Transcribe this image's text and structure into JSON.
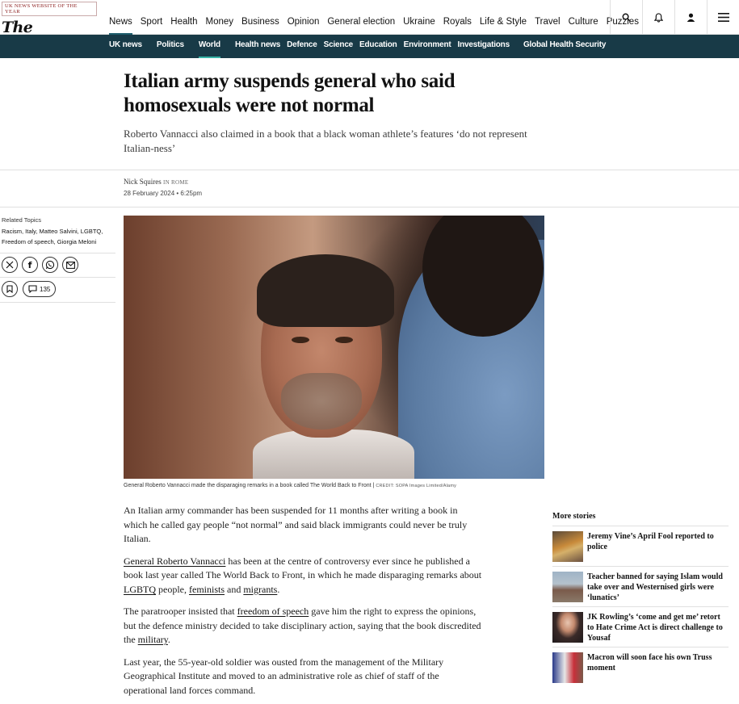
{
  "masthead": {
    "tagline": "UK NEWS WEBSITE OF THE YEAR",
    "logo": "The Telegraph",
    "nav": [
      "News",
      "Sport",
      "Health",
      "Money",
      "Business",
      "Opinion",
      "General election",
      "Ukraine",
      "Royals",
      "Life & Style",
      "Travel",
      "Culture",
      "Puzzles"
    ],
    "icons": [
      "search-icon",
      "bell-icon",
      "account-icon",
      "menu-icon"
    ]
  },
  "subnav": [
    "UK news",
    "Politics",
    "World",
    "Health news",
    "Defence",
    "Science",
    "Education",
    "Environment",
    "Investigations",
    "Global Health Security"
  ],
  "article": {
    "headline": "Italian army suspends general who said homosexuals were not normal",
    "standfirst": "Roberto Vannacci also claimed in a book that a black woman athlete’s features ‘do not represent Italian-ness’",
    "author": "Nick Squires",
    "location": "IN ROME",
    "date": "28 February 2024 • 6:25pm",
    "caption": "General Roberto Vannacci made the disparaging remarks in a book called The World Back to Front",
    "credit": "CREDIT: SOPA Images Limited/Alamy",
    "paragraphs": {
      "p1": "An Italian army commander has been suspended for 11 months after writing a book in which he called gay people “not normal” and said black immigrants could never be truly Italian.",
      "p2_link": "General Roberto Vannacci",
      "p2_a": " has been at the centre of controversy ever since he published a book last year called The World Back to Front, in which he made disparaging remarks about ",
      "p2_link2": "LGBTQ",
      "p2_b": " people, ",
      "p2_link3": "feminists",
      "p2_c": " and ",
      "p2_link4": "migrants",
      "p2_d": ".",
      "p3_a": "The paratrooper insisted that ",
      "p3_link": "freedom of speech",
      "p3_b": " gave him the right to express the opinions, but the defence ministry decided to take disciplinary action, saying that the book discredited the ",
      "p3_link2": "military",
      "p3_c": ".",
      "p4": "Last year, the 55-year-old soldier was ousted from the management of the Military Geographical Institute and moved to an administrative role as chief of staff of the operational land forces command."
    }
  },
  "sidebar": {
    "related_label": "Related Topics",
    "related_line1": "Racism, Italy, Matteo Salvini, LGBTQ,",
    "related_line2": "Freedom of speech, Giorgia Meloni",
    "share_icons": [
      "x-icon",
      "facebook-icon",
      "whatsapp-icon",
      "email-icon"
    ],
    "comment_count": "135"
  },
  "more_stories": {
    "title": "More stories",
    "items": [
      {
        "title": "Jeremy Vine’s April Fool reported to police"
      },
      {
        "title": "Teacher banned for saying Islam would take over and Westernised girls were ‘lunatics’"
      },
      {
        "title": "JK Rowling’s ‘come and get me’ retort to Hate Crime Act is direct challenge to Yousaf"
      },
      {
        "title": "Macron will soon face his own Truss moment"
      }
    ]
  },
  "colors": {
    "brand_dark": "#183a47",
    "accent": "#38b4a7",
    "text": "#121212"
  }
}
